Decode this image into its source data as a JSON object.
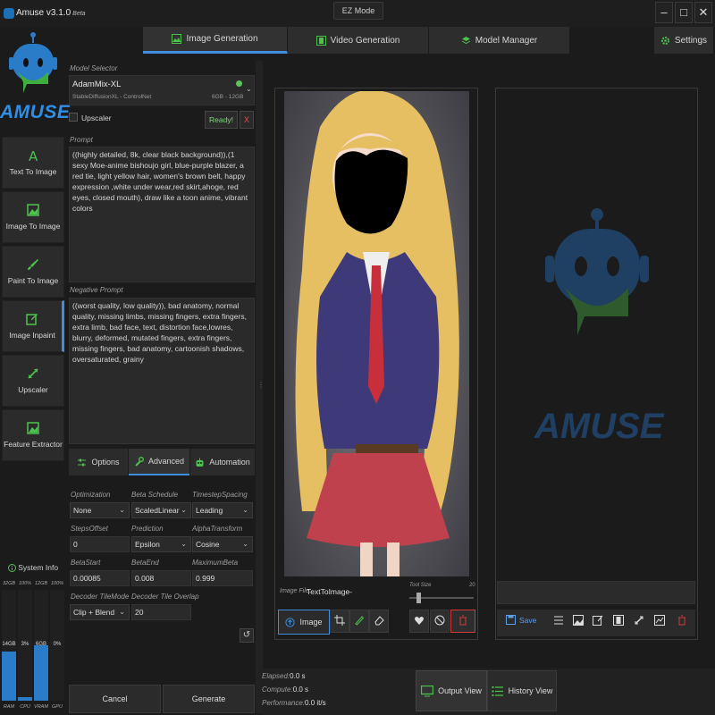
{
  "app": {
    "title": "Amuse v3.1.0",
    "badge": "Beta",
    "mode_button": "EZ Mode"
  },
  "tabs": [
    {
      "label": "Image Generation",
      "active": true,
      "icon": "image-icon"
    },
    {
      "label": "Video Generation",
      "active": false,
      "icon": "film-icon"
    },
    {
      "label": "Model Manager",
      "active": false,
      "icon": "stack-icon"
    }
  ],
  "settings_label": "Settings",
  "logo_text": "AMUSE",
  "nav": [
    {
      "label": "Text To Image",
      "icon": "text-icon"
    },
    {
      "label": "Image To Image",
      "icon": "image-icon"
    },
    {
      "label": "Paint To Image",
      "icon": "brush-icon"
    },
    {
      "label": "Image Inpaint",
      "icon": "edit-icon",
      "active": true
    },
    {
      "label": "Upscaler",
      "icon": "expand-icon"
    },
    {
      "label": "Feature Extractor",
      "icon": "image-icon"
    }
  ],
  "system_info": {
    "title": "System Info",
    "bars": [
      {
        "label": "RAM",
        "top": "32GB",
        "value": "14GB",
        "fraction": 0.44
      },
      {
        "label": "CPU",
        "top": "100%",
        "value": "3%",
        "fraction": 0.03
      },
      {
        "label": "VRAM",
        "top": "12GB",
        "value": "6GB",
        "fraction": 0.5
      },
      {
        "label": "GPU",
        "top": "100%",
        "value": "0%",
        "fraction": 0.0
      }
    ]
  },
  "model": {
    "section_label": "Model Selector",
    "name": "AdamMix-XL",
    "subtitle": "StableDiffusionXL - ControlNet",
    "memory": "6GB - 12GB",
    "upscaler_label": "Upscaler",
    "ready_label": "Ready!",
    "close_label": "X"
  },
  "prompt": {
    "label": "Prompt",
    "text": "((highly detailed, 8k, clear black background)),(1 sexy Moe-anime bishoujo girl, blue-purple blazer, a red tie, light yellow hair, women's brown belt, happy expression ,white under wear,red skirt,ahoge, red eyes, closed mouth), draw like a toon anime, vibrant colors"
  },
  "negative_prompt": {
    "label": "Negative Prompt",
    "text": "((worst quality, low quality)), bad anatomy, normal quality, missing limbs, missing fingers, extra fingers, extra limb, bad face, text, distortion face,lowres, blurry, deformed, mutated fingers, extra fingers, missing fingers, bad anatomy, cartoonish shadows, oversaturated, grainy"
  },
  "subtabs": [
    {
      "label": "Options",
      "active": false
    },
    {
      "label": "Advanced",
      "active": true
    },
    {
      "label": "Automation",
      "active": false
    }
  ],
  "advanced": {
    "optimization": {
      "label": "Optimization",
      "value": "None"
    },
    "beta_schedule": {
      "label": "Beta Schedule",
      "value": "ScaledLinear"
    },
    "timestep_spacing": {
      "label": "TimestepSpacing",
      "value": "Leading"
    },
    "steps_offset": {
      "label": "StepsOffset",
      "value": "0"
    },
    "prediction": {
      "label": "Prediction",
      "value": "Epsilon"
    },
    "alpha_transform": {
      "label": "AlphaTransform",
      "value": "Cosine"
    },
    "beta_start": {
      "label": "BetaStart",
      "value": "0.00085"
    },
    "beta_end": {
      "label": "BetaEnd",
      "value": "0.008"
    },
    "maximum_beta": {
      "label": "MaximumBeta",
      "value": "0.999"
    },
    "decoder_tile_mode": {
      "label": "Decoder TileMode",
      "value": "Clip + Blend"
    },
    "decoder_tile_overlap": {
      "label": "Decoder Tile Overlap",
      "value": "20"
    }
  },
  "actions": {
    "cancel": "Cancel",
    "generate": "Generate"
  },
  "output": {
    "image_file_label": "Image File:",
    "image_file_value": "TextToImage-",
    "tool_size_label": "Tool Size",
    "tool_size_value": "20",
    "tool_size_fraction": 0.12,
    "image_button": "Image"
  },
  "history": {
    "save_label": "Save",
    "logo_text": "AMUSE"
  },
  "stats": {
    "elapsed_label": "Elapsed:",
    "elapsed_value": "0.0 s",
    "compute_label": "Compute:",
    "compute_value": "0.0 s",
    "performance_label": "Performance:",
    "performance_value": "0.0 it/s"
  },
  "view_buttons": {
    "output": "Output View",
    "history": "History View"
  },
  "colors": {
    "accent": "#3f8de0",
    "ready": "#5cc35c",
    "danger": "#d23b3b",
    "icon_green": "#4cc24c"
  }
}
